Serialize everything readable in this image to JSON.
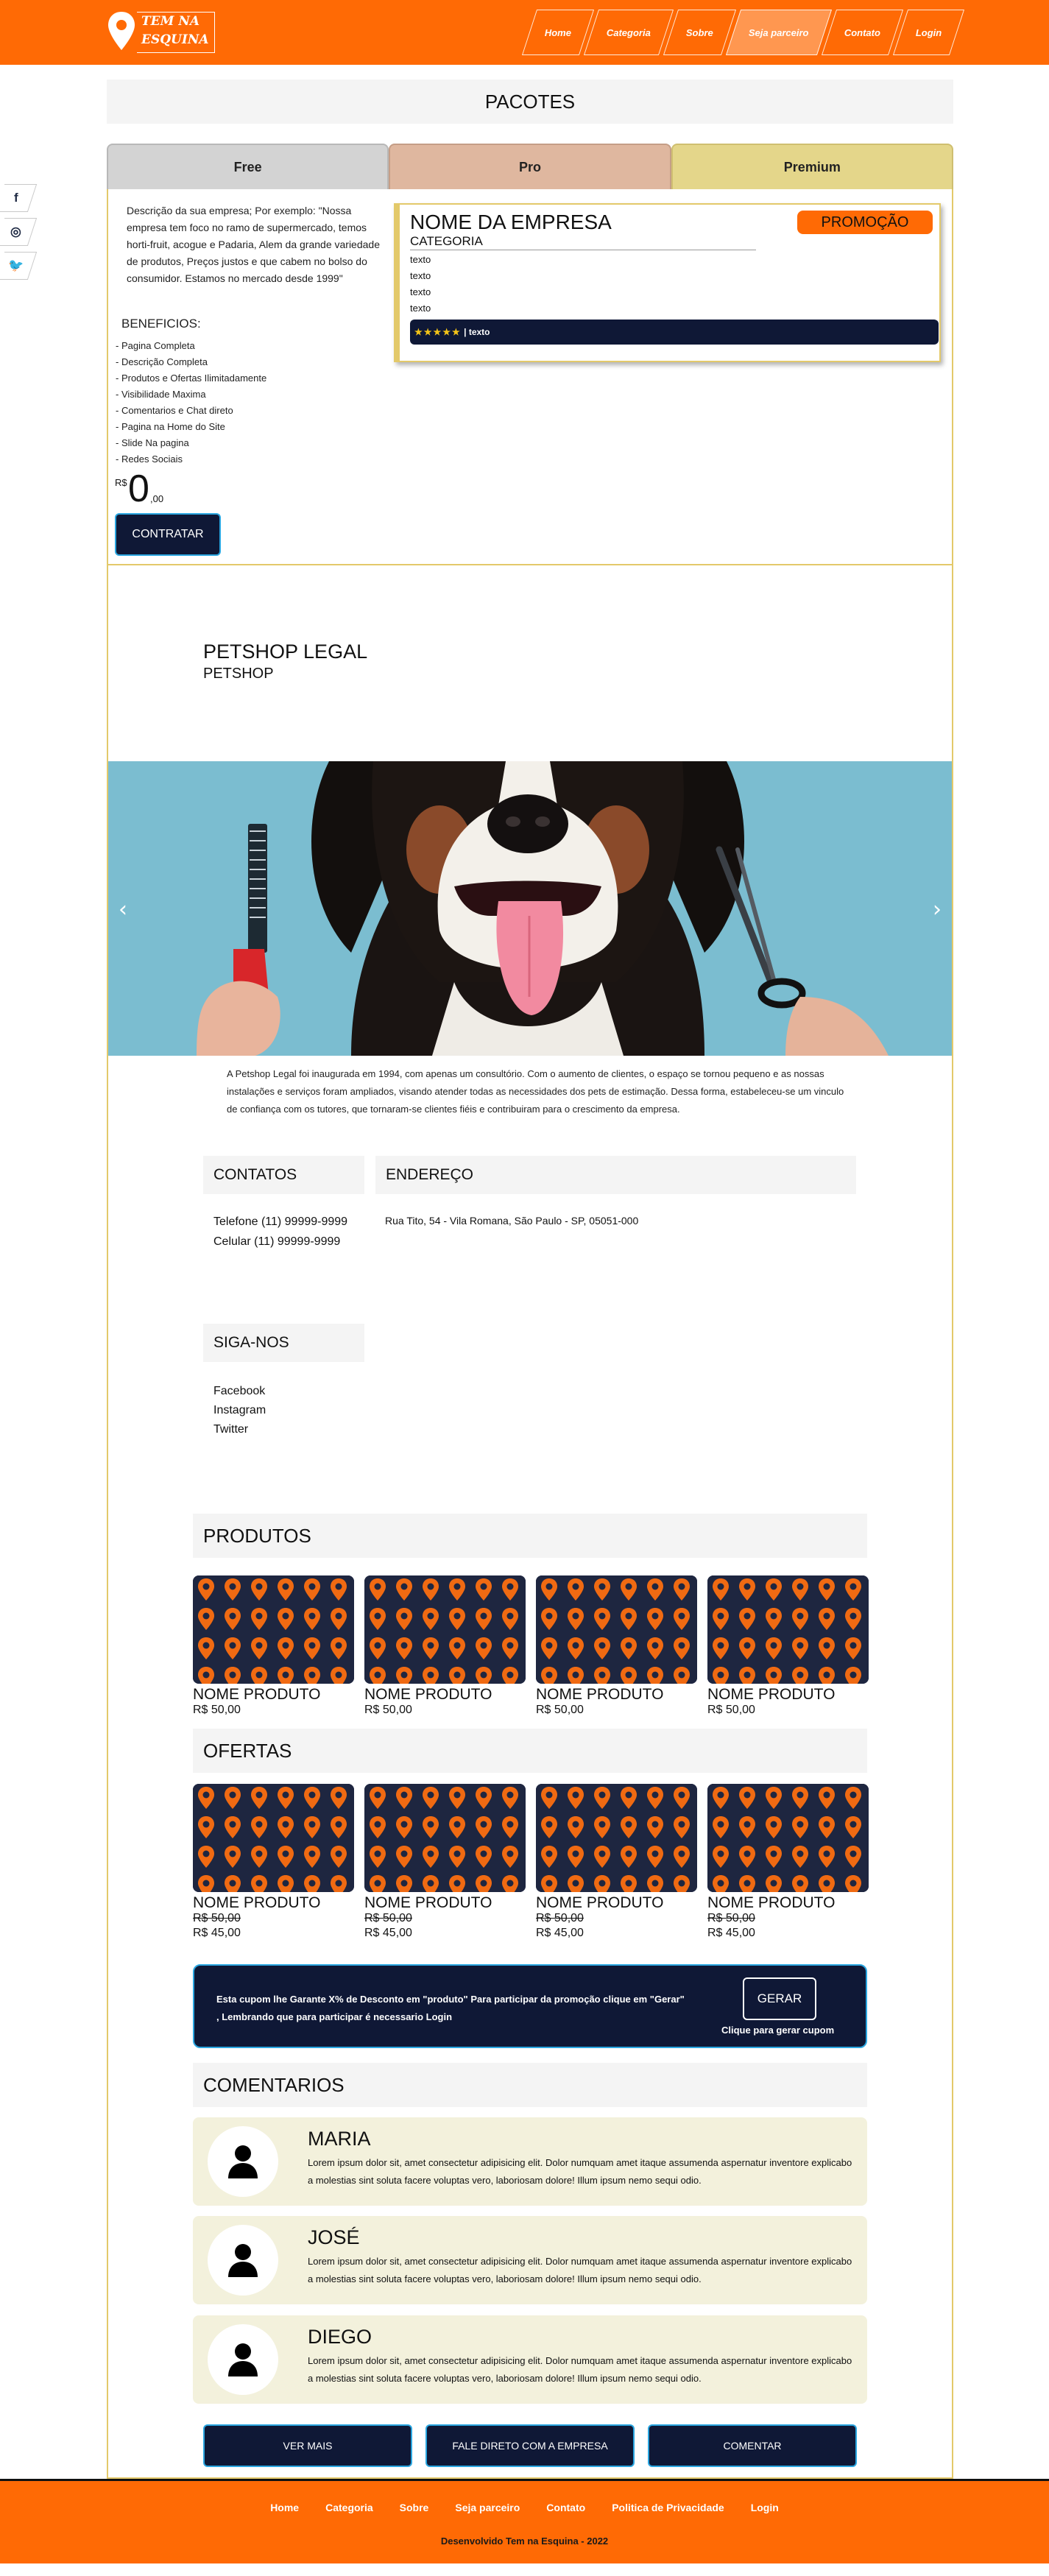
{
  "brand": {
    "line1": "TEM NA",
    "line2": "ESQUINA"
  },
  "nav": [
    {
      "label": "Home",
      "active": false
    },
    {
      "label": "Categoria",
      "active": false
    },
    {
      "label": "Sobre",
      "active": false
    },
    {
      "label": "Seja parceiro",
      "active": true
    },
    {
      "label": "Contato",
      "active": false
    },
    {
      "label": "Login",
      "active": false
    }
  ],
  "social": [
    {
      "icon": "facebook-icon",
      "glyph": "f"
    },
    {
      "icon": "instagram-icon",
      "glyph": "◎"
    },
    {
      "icon": "twitter-icon",
      "glyph": "🐦"
    }
  ],
  "pacotes": {
    "title": "PACOTES",
    "tabs": [
      "Free",
      "Pro",
      "Premium"
    ],
    "description": "Descrição da sua empresa; Por exemplo: \"Nossa empresa tem foco no ramo de supermercado, temos horti-fruit, acogue e Padaria, Alem da grande variedade de produtos, Preços justos e que cabem no bolso do consumidor. Estamos no mercado desde 1999\"",
    "benefits_title": "BENEFICIOS:",
    "benefits": [
      "- Pagina Completa",
      "- Descrição Completa",
      "- Produtos e Ofertas Ilimitadamente",
      "- Visibilidade Maxima",
      "- Comentarios e Chat direto",
      "- Pagina na Home do Site",
      "- Slide Na pagina",
      "- Redes Sociais"
    ],
    "price_currency": "R$",
    "price_value": "0",
    "price_cents": ",00",
    "cta": "CONTRATAR",
    "card": {
      "name": "NOME DA EMPRESA",
      "category": "CATEGORIA",
      "promo": "PROMOÇÃO",
      "lines": [
        "texto",
        "texto",
        "texto",
        "texto"
      ],
      "stars": "★★★★★",
      "rating_text": "| texto"
    }
  },
  "petshop": {
    "title": "PETSHOP LEGAL",
    "subtitle": "PETSHOP",
    "prev": "‹",
    "next": "›",
    "about": "A Petshop Legal foi inaugurada em 1994, com apenas um consultório. Com o aumento de clientes, o espaço se tornou pequeno e as nossas instalações e serviços foram ampliados, visando atender todas as necessidades dos pets de estimação. Dessa forma, estabeleceu-se um vinculo de confiança com os tutores, que tornaram-se clientes fiéis e contribuiram para o crescimento da empresa.",
    "contatos_title": "CONTATOS",
    "telefone": "Telefone (11) 99999-9999",
    "celular": "Celular (11) 99999-9999",
    "endereco_title": "ENDEREÇO",
    "endereco": "Rua Tito, 54 - Vila Romana, São Paulo - SP, 05051-000",
    "siga_title": "SIGA-NOS",
    "siga": [
      "Facebook",
      "Instagram",
      "Twitter"
    ]
  },
  "produtos": {
    "title": "PRODUTOS",
    "items": [
      {
        "name": "NOME PRODUTO",
        "price": "R$ 50,00"
      },
      {
        "name": "NOME PRODUTO",
        "price": "R$ 50,00"
      },
      {
        "name": "NOME PRODUTO",
        "price": "R$ 50,00"
      },
      {
        "name": "NOME PRODUTO",
        "price": "R$ 50,00"
      }
    ]
  },
  "ofertas": {
    "title": "OFERTAS",
    "items": [
      {
        "name": "NOME PRODUTO",
        "old_price": "R$ 50,00",
        "price": "R$ 45,00"
      },
      {
        "name": "NOME PRODUTO",
        "old_price": "R$ 50,00",
        "price": "R$ 45,00"
      },
      {
        "name": "NOME PRODUTO",
        "old_price": "R$ 50,00",
        "price": "R$ 45,00"
      },
      {
        "name": "NOME PRODUTO",
        "old_price": "R$ 50,00",
        "price": "R$ 45,00"
      }
    ]
  },
  "cupom": {
    "text": "Esta cupom lhe Garante X% de Desconto em \"produto\" Para participar da promoção clique em \"Gerar\" , Lembrando que para participar é necessario Login",
    "button": "GERAR",
    "hint": "Clique para gerar cupom"
  },
  "comentarios": {
    "title": "COMENTARIOS",
    "items": [
      {
        "name": "MARIA",
        "text": "Lorem ipsum dolor sit, amet consectetur adipisicing elit. Dolor numquam amet itaque assumenda aspernatur inventore explicabo a molestias sint soluta facere voluptas vero, laboriosam dolore! Illum ipsum nemo sequi odio."
      },
      {
        "name": "JOSÉ",
        "text": "Lorem ipsum dolor sit, amet consectetur adipisicing elit. Dolor numquam amet itaque assumenda aspernatur inventore explicabo a molestias sint soluta facere voluptas vero, laboriosam dolore! Illum ipsum nemo sequi odio."
      },
      {
        "name": "DIEGO",
        "text": "Lorem ipsum dolor sit, amet consectetur adipisicing elit. Dolor numquam amet itaque assumenda aspernatur inventore explicabo a molestias sint soluta facere voluptas vero, laboriosam dolore! Illum ipsum nemo sequi odio."
      }
    ]
  },
  "actions": {
    "ver_mais": "VER MAIS",
    "fale": "FALE DIRETO COM A EMPRESA",
    "comentar": "COMENTAR"
  },
  "footer": {
    "links": [
      "Home",
      "Categoria",
      "Sobre",
      "Seja parceiro",
      "Contato",
      "Politica de Privacidade",
      "Login"
    ],
    "copyright": "Desenvolvido Tem na Esquina - 2022"
  },
  "colors": {
    "brand_orange": "#ff6a05",
    "navy": "#0f1836",
    "gold": "#e3c96a",
    "accent_blue": "#2aa6e0"
  }
}
